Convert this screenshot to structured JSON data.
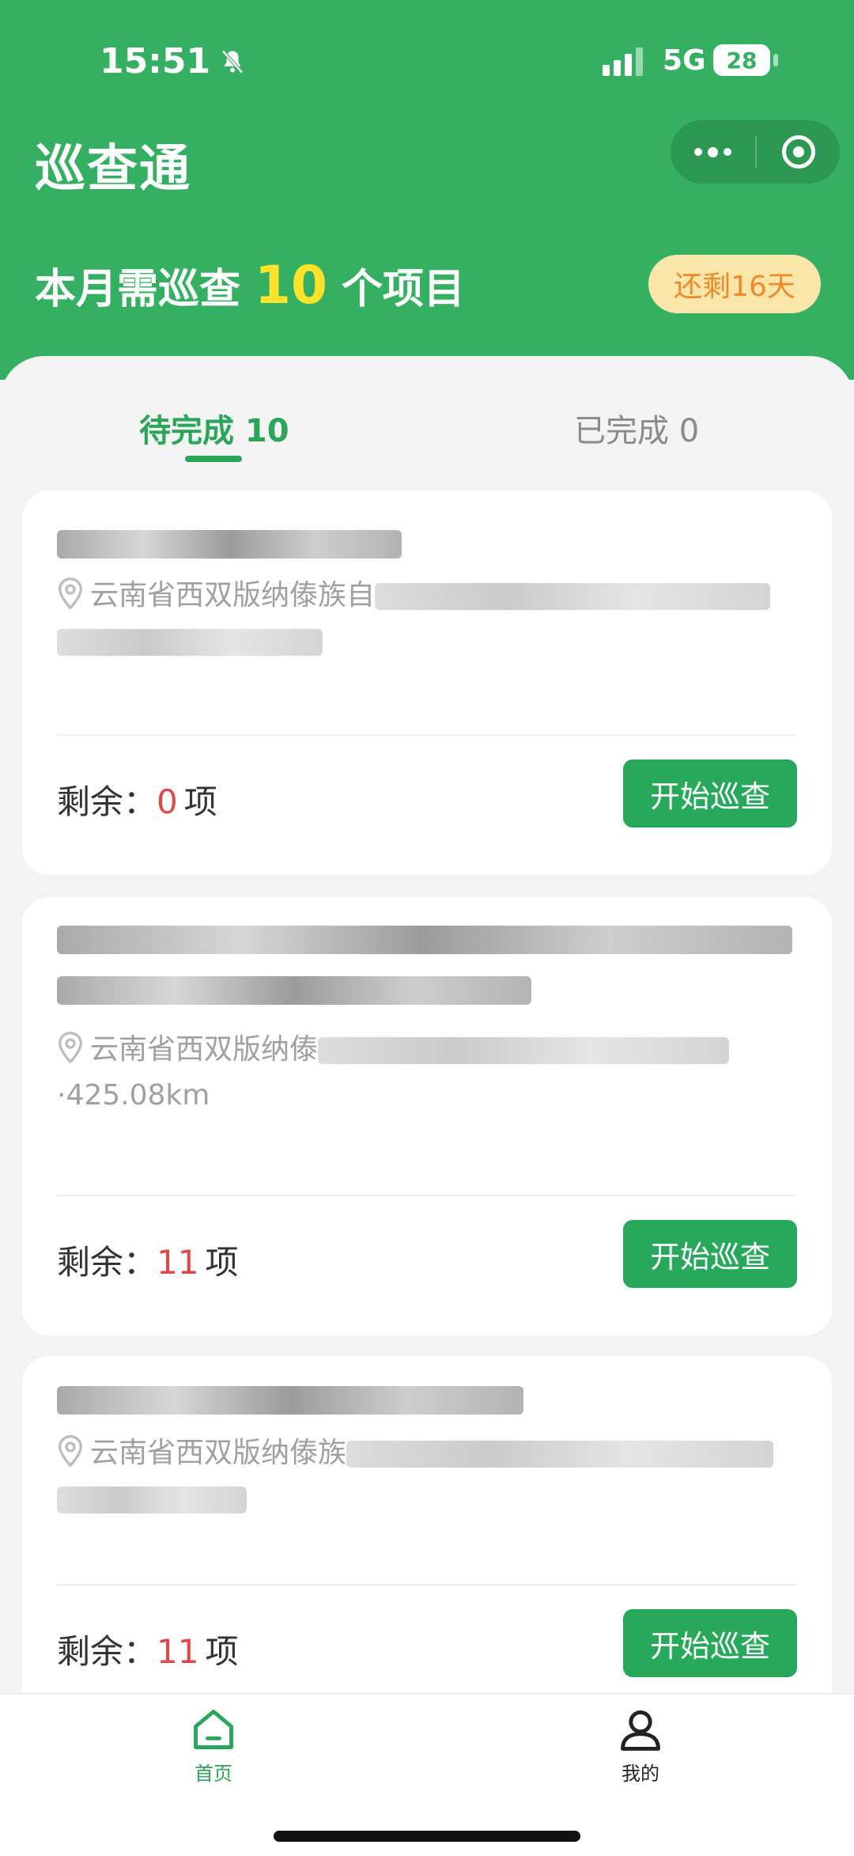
{
  "status_bar": {
    "time": "15:51",
    "network": "5G",
    "battery": "28"
  },
  "header": {
    "app_title": "巡查通",
    "summary_prefix": "本月需巡查",
    "summary_count": "10",
    "summary_suffix": "个项目",
    "days_left": "还剩16天"
  },
  "tabs": [
    {
      "label": "待完成 10",
      "active": true
    },
    {
      "label": "已完成 0",
      "active": false
    }
  ],
  "cards": [
    {
      "title_visible": "",
      "address_visible": "云南省西双版纳傣族自",
      "distance_visible": "",
      "remaining_label": "剩余：",
      "remaining_count": "0",
      "remaining_unit": "项",
      "button_label": "开始巡查"
    },
    {
      "title_visible": "",
      "address_visible": "云南省西双版纳傣",
      "distance_visible": "·425.08km",
      "remaining_label": "剩余：",
      "remaining_count": "11",
      "remaining_unit": "项",
      "button_label": "开始巡查"
    },
    {
      "title_visible": "",
      "address_visible": "云南省西双版纳傣族",
      "distance_visible": "",
      "remaining_label": "剩余：",
      "remaining_count": "11",
      "remaining_unit": "项",
      "button_label": "开始巡查"
    }
  ],
  "tabbar": {
    "home": "首页",
    "mine": "我的"
  },
  "colors": {
    "brand": "#35b062",
    "accent_yellow": "#ffe32b",
    "badge_bg": "#fbe6a9",
    "badge_text": "#ef8a2b",
    "count_red": "#e04848"
  },
  "icons": [
    "bell-muted-icon",
    "more-icon",
    "close-target-icon",
    "location-pin-icon",
    "home-icon",
    "user-icon"
  ]
}
